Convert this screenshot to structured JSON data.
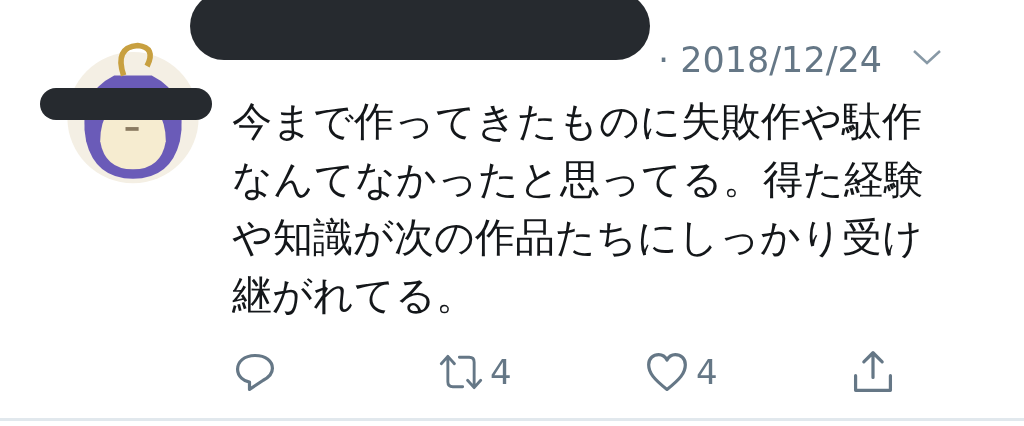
{
  "tweet": {
    "date": "· 2018/12/24",
    "text": "今まで作ってきたものに失敗作や駄作なんてなかったと思ってる。得た経験や知識が次の作品たちにしっかり受け継がれてる。",
    "actions": [
      {
        "kind": "reply"
      },
      {
        "kind": "retweet",
        "count": "4"
      },
      {
        "kind": "like",
        "count": "4"
      },
      {
        "kind": "share"
      }
    ]
  }
}
